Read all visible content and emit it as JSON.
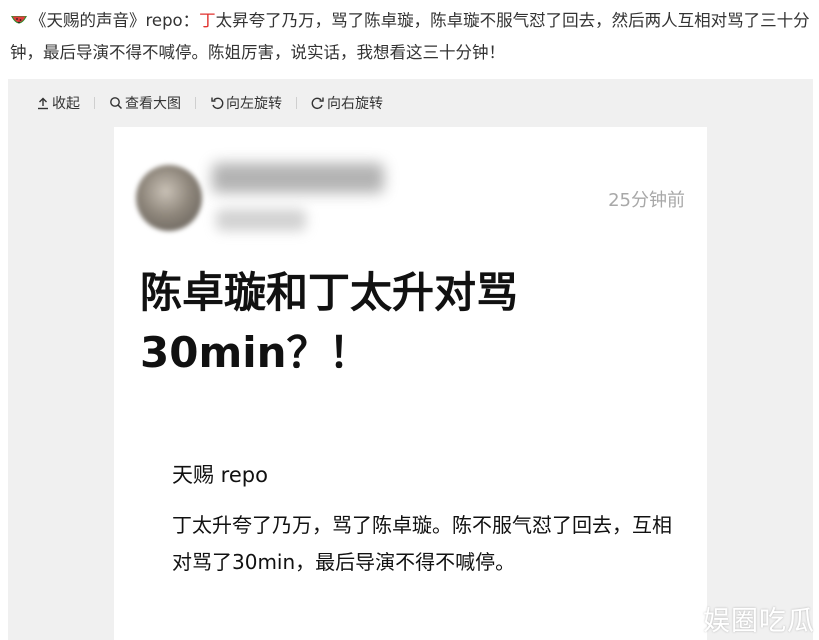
{
  "headline": {
    "icon": "watermelon-icon",
    "prefix": "《天赐的声音》repo：",
    "highlight": "丁",
    "rest": "太昇夸了乃万，骂了陈卓璇，陈卓璇不服气怼了回去，然后两人互相对骂了三十分钟，最后导演不得不喊停。陈姐厉害，说实话，我想看这三十分钟！"
  },
  "toolbar": {
    "collapse_label": "收起",
    "view_large_label": "查看大图",
    "rotate_left_label": "向左旋转",
    "rotate_right_label": "向右旋转"
  },
  "post": {
    "time": "25分钟前",
    "title": "陈卓璇和丁太升对骂30min？！",
    "quote_author": "天赐  repo",
    "quote_body": "丁太升夸了乃万，骂了陈卓璇。陈不服气怼了回去，互相对骂了30min，最后导演不得不喊停。"
  },
  "watermark": "娱圈吃瓜",
  "colors": {
    "highlight": "#e0332f",
    "viewer_bg": "#f0f0f0"
  }
}
